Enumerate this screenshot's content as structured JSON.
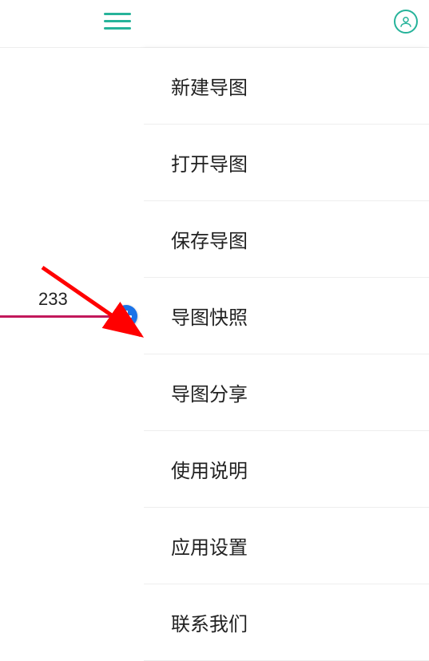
{
  "node": {
    "label": "233"
  },
  "menu": {
    "group1": [
      {
        "label": "新建导图"
      },
      {
        "label": "打开导图"
      },
      {
        "label": "保存导图"
      },
      {
        "label": "导图快照"
      },
      {
        "label": "导图分享"
      }
    ],
    "group2": [
      {
        "label": "使用说明"
      },
      {
        "label": "应用设置"
      },
      {
        "label": "联系我们"
      }
    ]
  }
}
